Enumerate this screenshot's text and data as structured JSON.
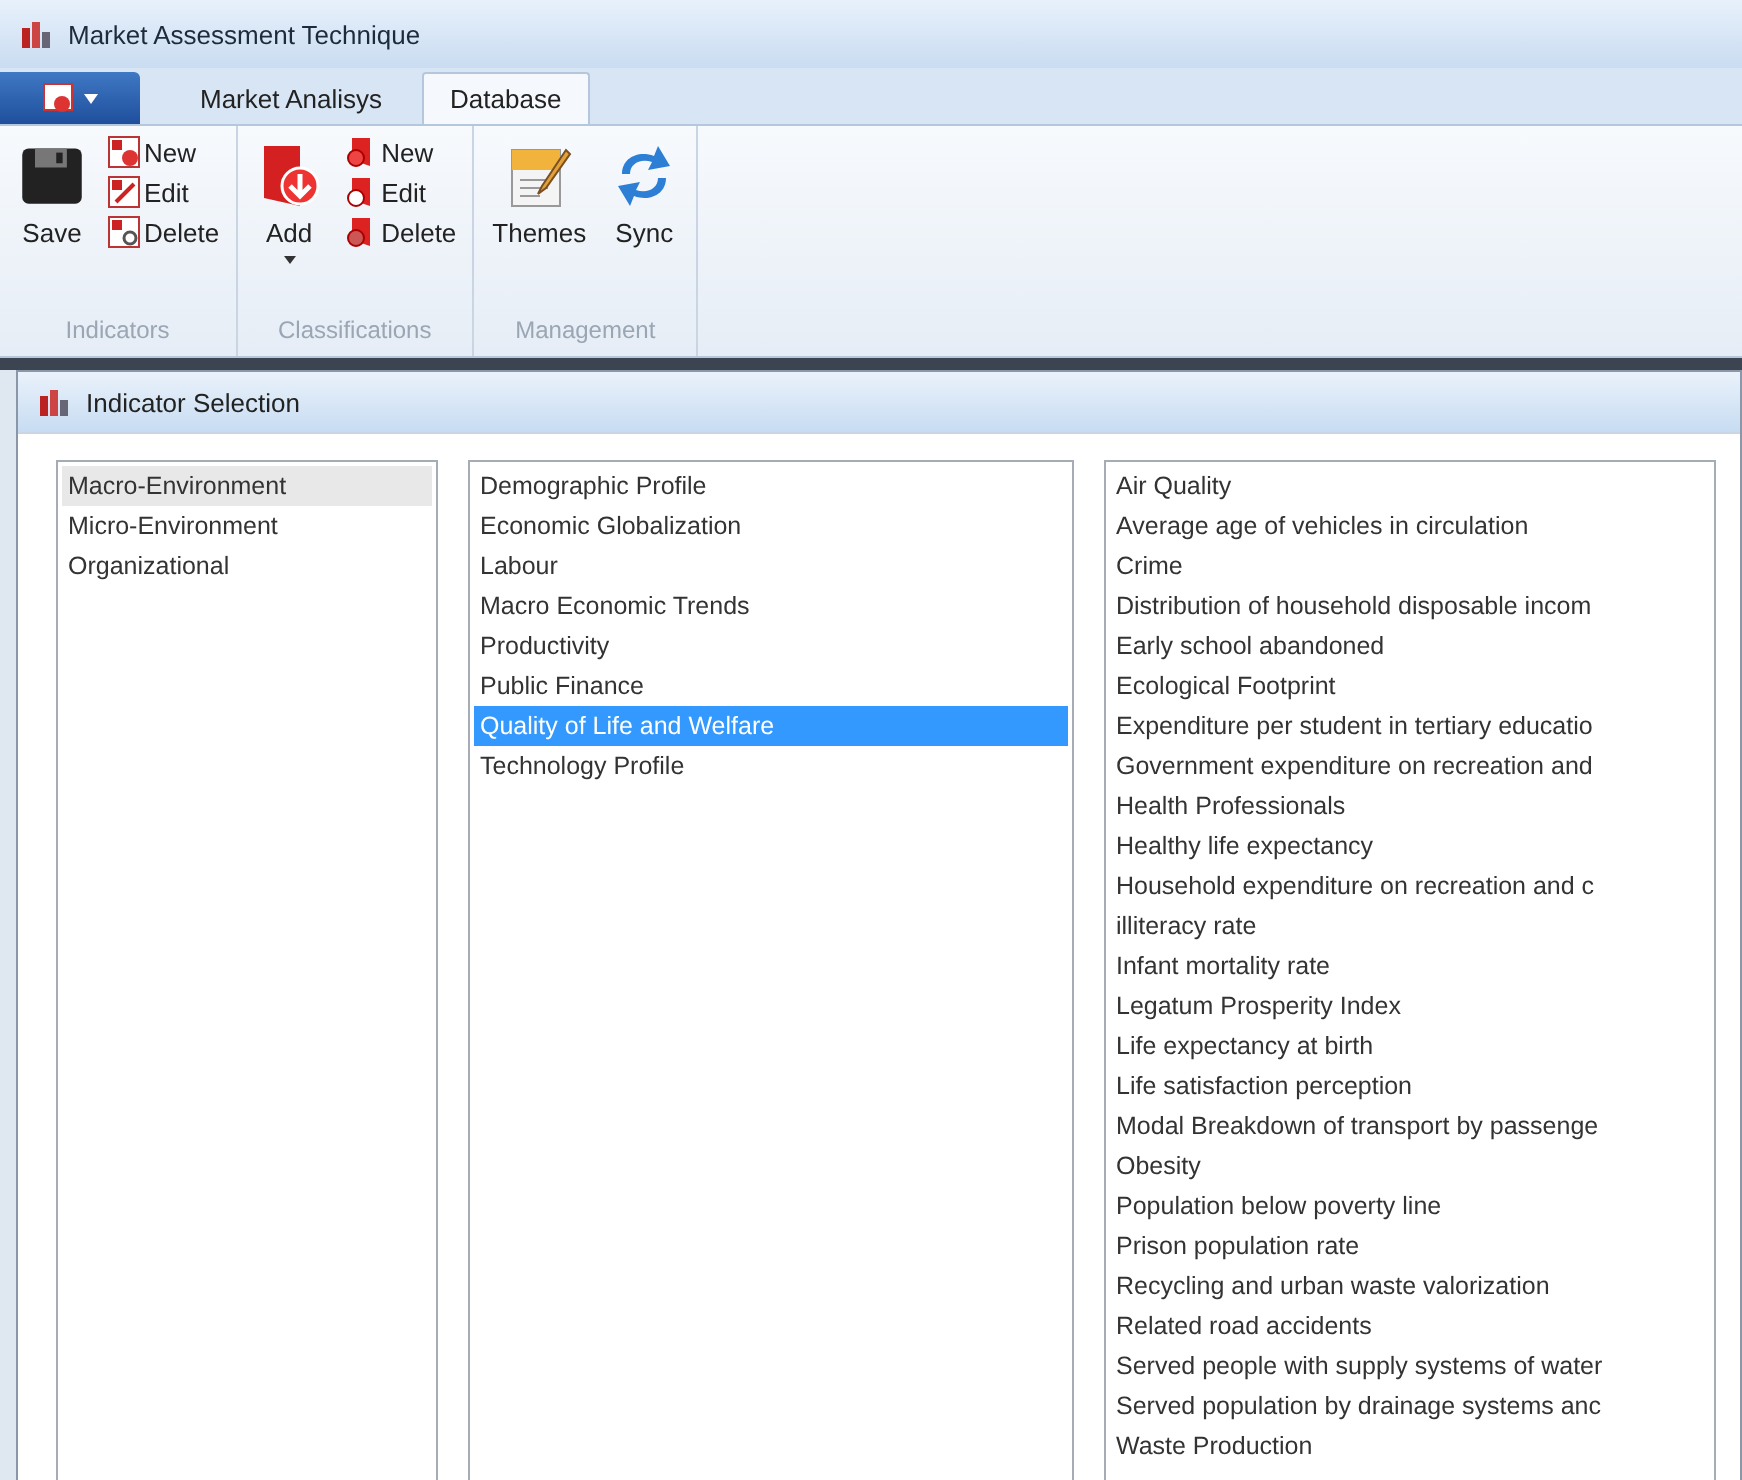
{
  "window": {
    "title": "Market Assessment Technique"
  },
  "ribbon_tabs": [
    {
      "label": "Market Analisys",
      "selected": false
    },
    {
      "label": "Database",
      "selected": true
    }
  ],
  "ribbon_groups": [
    {
      "label": "Indicators",
      "large": [
        {
          "label": "Save",
          "kind": "save",
          "dropdown": false
        }
      ],
      "small": [
        {
          "label": "New",
          "kind": "new"
        },
        {
          "label": "Edit",
          "kind": "edit"
        },
        {
          "label": "Delete",
          "kind": "delete"
        }
      ]
    },
    {
      "label": "Classifications",
      "large": [
        {
          "label": "Add",
          "kind": "add",
          "dropdown": true
        }
      ],
      "small": [
        {
          "label": "New",
          "kind": "folder-new"
        },
        {
          "label": "Edit",
          "kind": "folder-edit"
        },
        {
          "label": "Delete",
          "kind": "folder-delete"
        }
      ]
    },
    {
      "label": "Management",
      "large": [
        {
          "label": "Themes",
          "kind": "themes",
          "dropdown": false
        },
        {
          "label": "Sync",
          "kind": "sync",
          "dropdown": false
        }
      ]
    }
  ],
  "panel": {
    "title": "Indicator Selection"
  },
  "lists": [
    {
      "items": [
        {
          "label": "Macro-Environment",
          "selected": true
        },
        {
          "label": "Micro-Environment",
          "selected": false
        },
        {
          "label": "Organizational",
          "selected": false
        }
      ]
    },
    {
      "items": [
        {
          "label": "Demographic Profile",
          "selected": false
        },
        {
          "label": "Economic Globalization",
          "selected": false
        },
        {
          "label": "Labour",
          "selected": false
        },
        {
          "label": "Macro Economic Trends",
          "selected": false
        },
        {
          "label": "Productivity",
          "selected": false
        },
        {
          "label": "Public Finance",
          "selected": false
        },
        {
          "label": "Quality of Life and Welfare",
          "selected": true
        },
        {
          "label": "Technology Profile",
          "selected": false
        }
      ]
    },
    {
      "items": [
        {
          "label": "Air Quality",
          "selected": false
        },
        {
          "label": "Average age of vehicles in circulation",
          "selected": false
        },
        {
          "label": "Crime",
          "selected": false
        },
        {
          "label": "Distribution of household disposable incom",
          "selected": false
        },
        {
          "label": "Early school abandoned",
          "selected": false
        },
        {
          "label": "Ecological Footprint",
          "selected": false
        },
        {
          "label": "Expenditure per student in tertiary educatio",
          "selected": false
        },
        {
          "label": "Government expenditure on recreation and",
          "selected": false
        },
        {
          "label": "Health Professionals",
          "selected": false
        },
        {
          "label": "Healthy life expectancy",
          "selected": false
        },
        {
          "label": "Household expenditure on recreation and c",
          "selected": false
        },
        {
          "label": "illiteracy rate",
          "selected": false
        },
        {
          "label": "Infant mortality rate",
          "selected": false
        },
        {
          "label": "Legatum Prosperity Index",
          "selected": false
        },
        {
          "label": "Life expectancy at birth",
          "selected": false
        },
        {
          "label": "Life satisfaction perception",
          "selected": false
        },
        {
          "label": "Modal Breakdown of transport by passenge",
          "selected": false
        },
        {
          "label": "Obesity",
          "selected": false
        },
        {
          "label": "Population below poverty line",
          "selected": false
        },
        {
          "label": "Prison population rate",
          "selected": false
        },
        {
          "label": "Recycling and urban waste valorization",
          "selected": false
        },
        {
          "label": "Related road accidents",
          "selected": false
        },
        {
          "label": "Served people with supply systems of water",
          "selected": false
        },
        {
          "label": "Served population by  drainage systems anc",
          "selected": false
        },
        {
          "label": "Waste Production",
          "selected": false
        }
      ]
    }
  ]
}
